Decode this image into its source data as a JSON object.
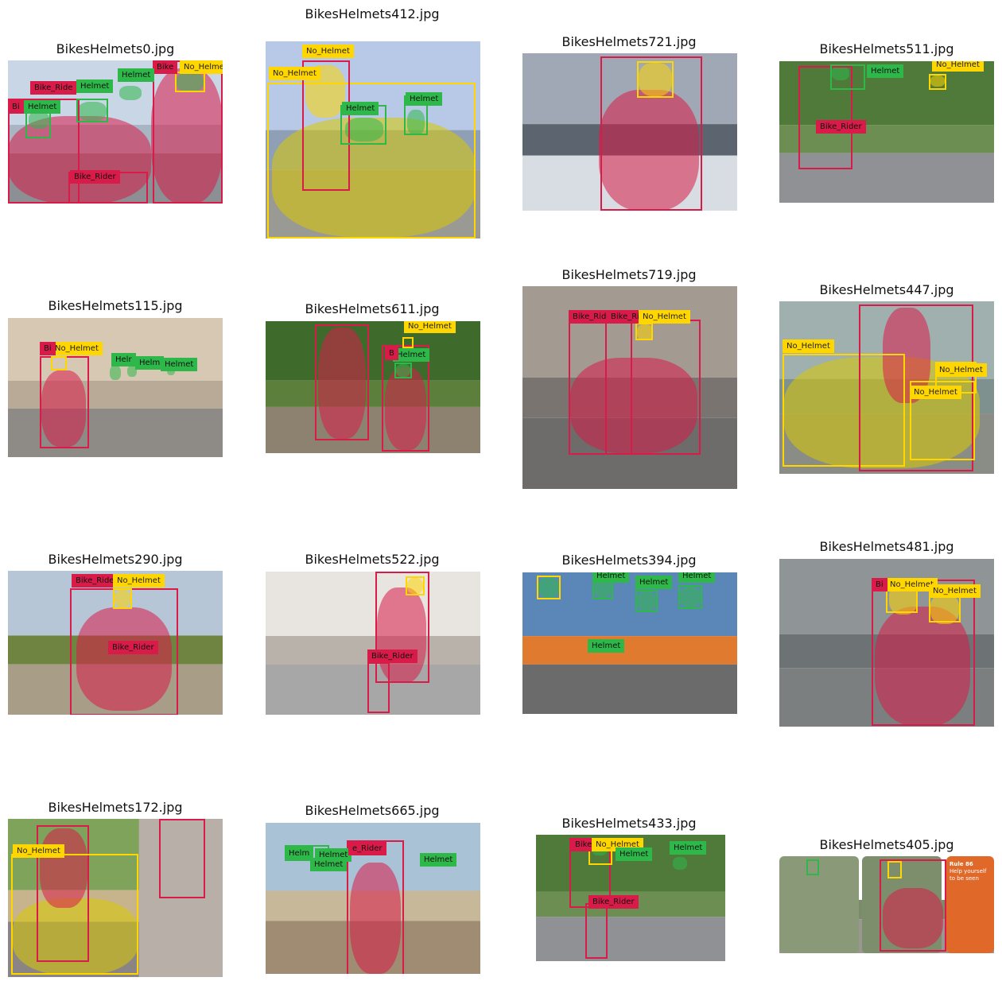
{
  "colors": {
    "Bike_Rider": "#d81b48",
    "Helmet": "#2fb84a",
    "No_Helmet": "#ffd600",
    "motorcycle": "#d9c800"
  },
  "panels": [
    {
      "title": "BikesHelmets0.jpg",
      "scene": "city",
      "labels": [
        {
          "cls": "Bike_Rider",
          "text": "Bike_Ride"
        },
        {
          "cls": "Bike_Rider",
          "text": "Bi"
        },
        {
          "cls": "Bike_Rider",
          "text": "Bike"
        },
        {
          "cls": "Helmet",
          "text": "Helmet"
        },
        {
          "cls": "Helmet",
          "text": "Helmet"
        },
        {
          "cls": "Helmet",
          "text": "Helmet"
        },
        {
          "cls": "No_Helmet",
          "text": "No_Helme"
        },
        {
          "cls": "Bike_Rider",
          "text": "Bike_Rider"
        },
        {
          "cls": "Bike_Rider",
          "text": "Bi"
        }
      ]
    },
    {
      "title": "BikesHelmets412.jpg",
      "scene": "parking",
      "labels": [
        {
          "cls": "No_Helmet",
          "text": "No_Helmet"
        },
        {
          "cls": "No_Helmet",
          "text": "No_Helmet"
        },
        {
          "cls": "Helmet",
          "text": "Helmet"
        },
        {
          "cls": "Helmet",
          "text": "Helmet"
        }
      ]
    },
    {
      "title": "BikesHelmets721.jpg",
      "scene": "road",
      "labels": []
    },
    {
      "title": "BikesHelmets511.jpg",
      "scene": "street",
      "labels": [
        {
          "cls": "Helmet",
          "text": "Helmet"
        },
        {
          "cls": "No_Helmet",
          "text": "No_Helmet"
        },
        {
          "cls": "Bike_Rider",
          "text": "Bike_Rider"
        }
      ]
    },
    {
      "title": "BikesHelmets115.jpg",
      "scene": "fog",
      "labels": [
        {
          "cls": "No_Helmet",
          "text": "No_Helmet"
        },
        {
          "cls": "Helmet",
          "text": "Helr"
        },
        {
          "cls": "Helmet",
          "text": "Helm"
        },
        {
          "cls": "Helmet",
          "text": "Helmet"
        },
        {
          "cls": "Bike_Rider",
          "text": "Bi"
        }
      ]
    },
    {
      "title": "BikesHelmets611.jpg",
      "scene": "park",
      "labels": [
        {
          "cls": "No_Helmet",
          "text": "No_Helmet"
        },
        {
          "cls": "Helmet",
          "text": "Helmet"
        },
        {
          "cls": "Bike_Rider",
          "text": "B"
        }
      ]
    },
    {
      "title": "BikesHelmets719.jpg",
      "scene": "traffic",
      "labels": [
        {
          "cls": "Bike_Rider",
          "text": "Bike_Ride"
        },
        {
          "cls": "Bike_Rider",
          "text": "Bike_Ri"
        },
        {
          "cls": "No_Helmet",
          "text": "No_Helmet"
        }
      ]
    },
    {
      "title": "BikesHelmets447.jpg",
      "scene": "fence",
      "labels": [
        {
          "cls": "No_Helmet",
          "text": "No_Helmet"
        },
        {
          "cls": "No_Helmet",
          "text": "No_Helmet"
        },
        {
          "cls": "No_Helmet",
          "text": "No_Helmet"
        }
      ]
    },
    {
      "title": "BikesHelmets290.jpg",
      "scene": "field",
      "labels": [
        {
          "cls": "Bike_Rider",
          "text": "Bike_Ride"
        },
        {
          "cls": "No_Helmet",
          "text": "No_Helmet"
        },
        {
          "cls": "Bike_Rider",
          "text": "Bike_Rider"
        }
      ]
    },
    {
      "title": "BikesHelmets522.jpg",
      "scene": "avenue",
      "labels": [
        {
          "cls": "Bike_Rider",
          "text": "Bike_Rider"
        }
      ]
    },
    {
      "title": "BikesHelmets394.jpg",
      "scene": "crowd",
      "labels": [
        {
          "cls": "Helmet",
          "text": "Helmet"
        },
        {
          "cls": "Helmet",
          "text": "Helmet"
        },
        {
          "cls": "Helmet",
          "text": "Helmet"
        },
        {
          "cls": "Helmet",
          "text": "Helmet"
        }
      ]
    },
    {
      "title": "BikesHelmets481.jpg",
      "scene": "grey",
      "labels": [
        {
          "cls": "No_Helmet",
          "text": "No_Helmet"
        },
        {
          "cls": "No_Helmet",
          "text": "No_Helmet"
        },
        {
          "cls": "Bike_Rider",
          "text": "Bi"
        }
      ]
    },
    {
      "title": "BikesHelmets172.jpg",
      "scene": "collage",
      "labels": [
        {
          "cls": "No_Helmet",
          "text": "No_Helmet"
        }
      ]
    },
    {
      "title": "BikesHelmets665.jpg",
      "scene": "beach",
      "labels": [
        {
          "cls": "Helmet",
          "text": "Helm"
        },
        {
          "cls": "Helmet",
          "text": "Helmet"
        },
        {
          "cls": "Helmet",
          "text": "Helmet"
        },
        {
          "cls": "Bike_Rider",
          "text": "e_Rider"
        },
        {
          "cls": "Helmet",
          "text": "Helmet"
        }
      ]
    },
    {
      "title": "BikesHelmets433.jpg",
      "scene": "street",
      "labels": [
        {
          "cls": "Bike_Rider",
          "text": "Bike"
        },
        {
          "cls": "No_Helmet",
          "text": "No_Helmet"
        },
        {
          "cls": "Helmet",
          "text": "Helmet"
        },
        {
          "cls": "Helmet",
          "text": "Helmet"
        },
        {
          "cls": "Bike_Rider",
          "text": "Bike_Rider"
        }
      ]
    },
    {
      "title": "BikesHelmets405.jpg",
      "scene": "poster",
      "labels": [],
      "poster": {
        "heading": "Rule 86",
        "line1": "Help yourself",
        "line2": "to be seen"
      }
    }
  ]
}
